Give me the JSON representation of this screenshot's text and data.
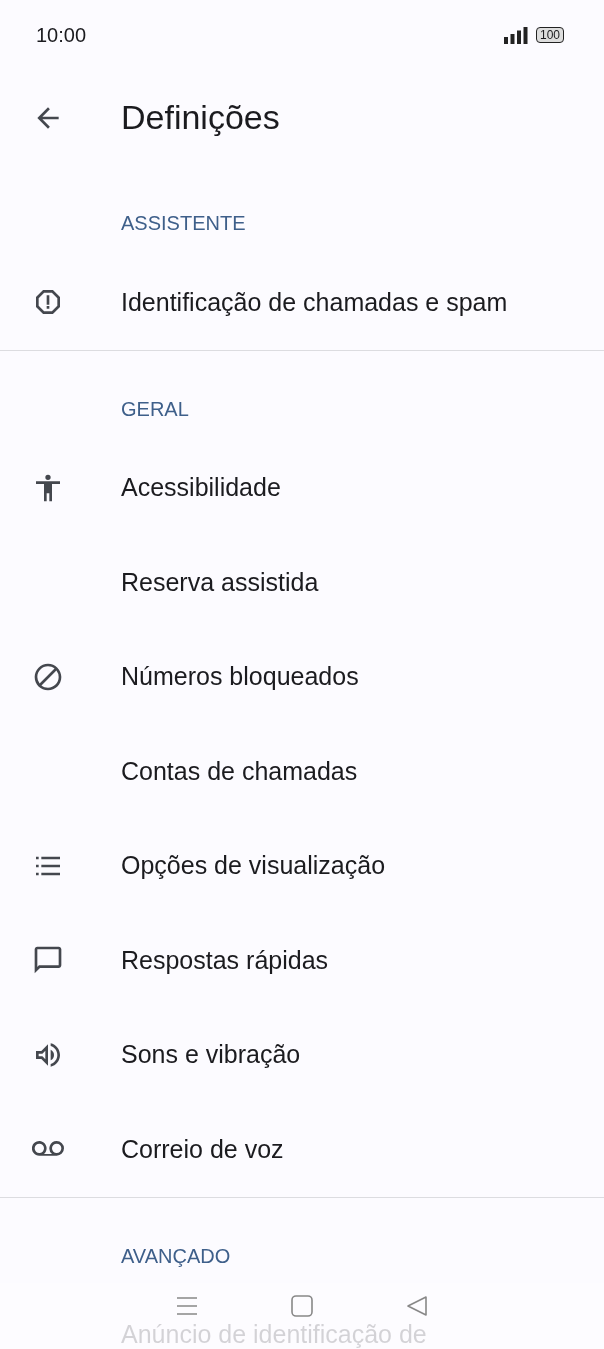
{
  "status_bar": {
    "time": "10:00",
    "battery": "100"
  },
  "header": {
    "title": "Definições"
  },
  "sections": [
    {
      "title": "ASSISTENTE",
      "items": [
        {
          "label": "Identificação de chamadas e spam",
          "kind": "alert"
        }
      ]
    },
    {
      "title": "GERAL",
      "items": [
        {
          "label": "Acessibilidade",
          "kind": "accessibility"
        },
        {
          "label": "Reserva assistida",
          "kind": "plain"
        },
        {
          "label": "Números bloqueados",
          "kind": "block"
        },
        {
          "label": "Contas de chamadas",
          "kind": "plain"
        },
        {
          "label": "Opções de visualização",
          "kind": "list"
        },
        {
          "label": "Respostas rápidas",
          "kind": "message"
        },
        {
          "label": "Sons e vibração",
          "kind": "volume"
        },
        {
          "label": "Correio de voz",
          "kind": "voicemail"
        }
      ]
    },
    {
      "title": "AVANÇADO",
      "items": [
        {
          "label": "Anúncio de identificação de",
          "kind": "plain"
        }
      ]
    }
  ]
}
